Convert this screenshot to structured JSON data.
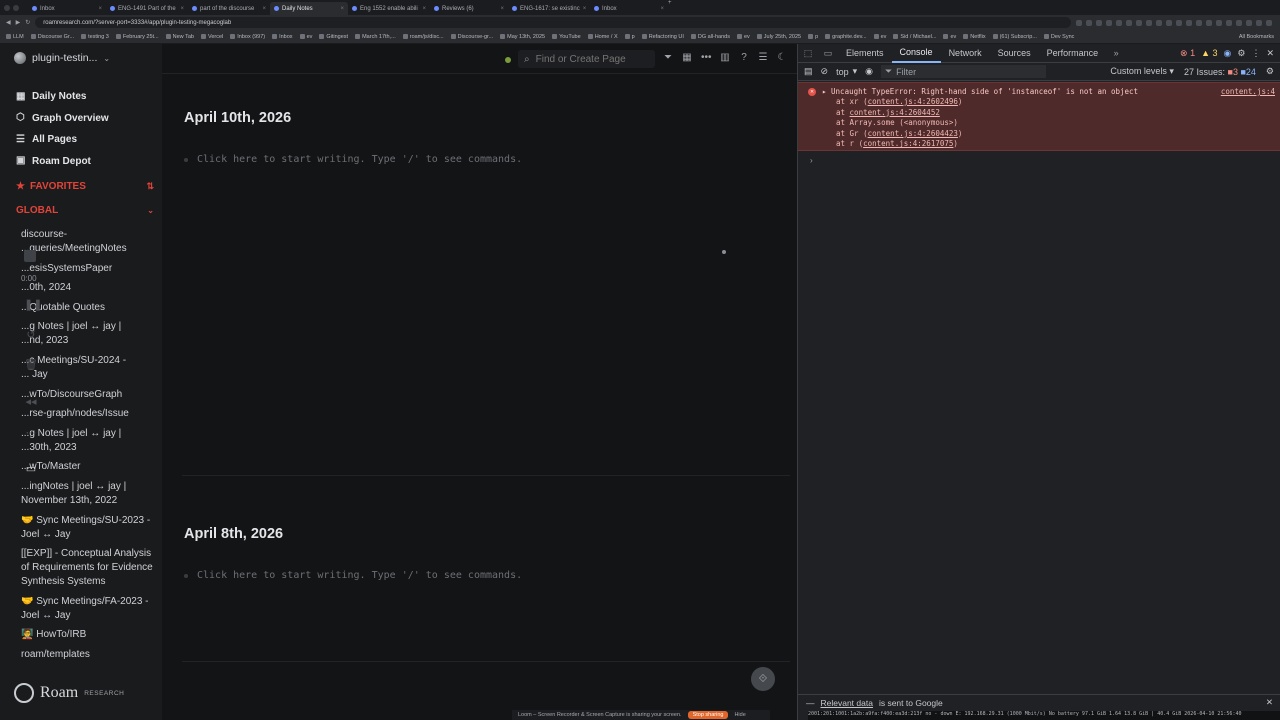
{
  "browser": {
    "tabs": [
      {
        "label": "Inbox",
        "active": false
      },
      {
        "label": "ENG-1491 Part of the",
        "active": false
      },
      {
        "label": "part of the discourse",
        "active": false
      },
      {
        "label": "Daily Notes",
        "active": true
      },
      {
        "label": "Eng 1552 enable abili",
        "active": false
      },
      {
        "label": "Reviews (6)",
        "active": false
      },
      {
        "label": "ENG-1617: se existinc",
        "active": false
      },
      {
        "label": "Inbox",
        "active": false
      }
    ],
    "url": "roamresearch.com/?server-port=3333#/app/plugin-testing-megacoglab",
    "bookmarks": [
      "LLM",
      "Discourse Gr...",
      "testing 3",
      "February 25t...",
      "New Tab",
      "Vercel",
      "Inbox (997)",
      "Inbox",
      "ev",
      "Gitingest",
      "March 17th,...",
      "roam/js/disc...",
      "Discourse-gr...",
      "May 13th, 2025",
      "YouTube",
      "Home / X",
      "p",
      "Refactoring UI",
      "DG all-hands",
      "ev",
      "July 25th, 2025",
      "p",
      "graphite.dev...",
      "ev",
      "Sid / Michael...",
      "ev",
      "Netflix",
      "(61) Subscrip...",
      "Dev Sync"
    ],
    "all_bookmarks": "All Bookmarks"
  },
  "sidebar": {
    "graph_name": "plugin-testin...",
    "nav": [
      {
        "label": "Daily Notes",
        "icon": "calendar-icon"
      },
      {
        "label": "Graph Overview",
        "icon": "graph-icon"
      },
      {
        "label": "All Pages",
        "icon": "list-icon"
      },
      {
        "label": "Roam Depot",
        "icon": "store-icon"
      }
    ],
    "favorites_label": "FAVORITES",
    "global_label": "GLOBAL",
    "shortcuts": [
      "discourse-\n...queries/MeetingNotes",
      "...esisSystemsPaper",
      "...0th, 2024",
      "...Quotable Quotes",
      "...g Notes | joel ↔ jay |\n...nd, 2023",
      "...c Meetings/SU-2024 -\n... Jay",
      "...wTo/DiscourseGraph",
      "...rse-graph/nodes/Issue",
      "...g Notes | joel ↔ jay |\n...30th, 2023",
      "...wTo/Master",
      "...ingNotes | joel ↔ jay |\nNovember 13th, 2022",
      "🤝 Sync Meetings/SU-2023 -\nJoel ↔ Jay",
      "[[EXP]] - Conceptual Analysis\nof Requirements for Evidence\nSynthesis Systems",
      "🤝 Sync Meetings/FA-2023 -\nJoel ↔ Jay",
      "🧑‍🏫 HowTo/IRB",
      "roam/templates"
    ],
    "brand": "Roam",
    "brand_sub": "RESEARCH"
  },
  "loom": {
    "timer": "0:00",
    "sharing_text": "Loom – Screen Recorder & Screen Capture is sharing your screen.",
    "stop_label": "Stop sharing",
    "hide_label": "Hide"
  },
  "main": {
    "search_placeholder": "Find or Create Page",
    "pages": [
      {
        "title": "April 10th, 2026",
        "placeholder": "Click here to start writing. Type '/' to see commands."
      },
      {
        "title": "April 8th, 2026",
        "placeholder": "Click here to start writing. Type '/' to see commands."
      }
    ]
  },
  "devtools": {
    "tabs": [
      "Elements",
      "Console",
      "Network",
      "Sources",
      "Performance"
    ],
    "active_tab": "Console",
    "error_count": "1",
    "warning_count": "3",
    "context": "top",
    "filter_placeholder": "Filter",
    "levels": "Custom levels",
    "issues_label": "27 Issues:",
    "issues_errors": "3",
    "issues_info": "24",
    "error_message": "Uncaught TypeError: Right-hand side of 'instanceof' is not an object",
    "error_source": "content.js:4",
    "stack": [
      {
        "prefix": "at xr (",
        "link": "content.js:4:2602496",
        "suffix": ")"
      },
      {
        "prefix": "at ",
        "link": "content.js:4:2604452",
        "suffix": ""
      },
      {
        "prefix": "at Array.some (<anonymous>)",
        "link": "",
        "suffix": ""
      },
      {
        "prefix": "at Gr (",
        "link": "content.js:4:2604423",
        "suffix": ")"
      },
      {
        "prefix": "at r (",
        "link": "content.js:4:2617075",
        "suffix": ")"
      }
    ],
    "footer_link": "Relevant data",
    "footer_text": "is sent to Google"
  },
  "sysbar": "2001:201:1001:1a2b:a9fa:f400:ea3d:213f no - down E: 192.168.29.31 (1000 Mbit/s) No battery 97.1 GiB 1.64 13.8 GiB | 40.4 GiB 2026-04-10 21:56:40"
}
